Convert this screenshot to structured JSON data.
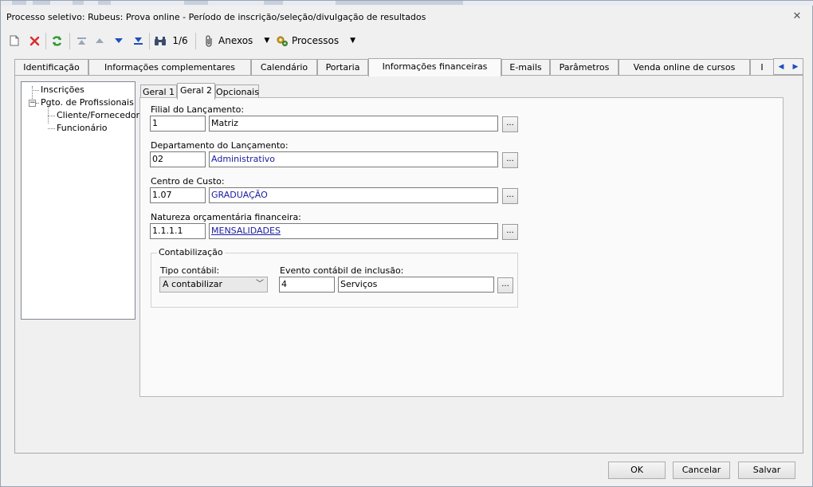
{
  "window": {
    "title": "Processo seletivo: Rubeus: Prova online - Período de inscrição/seleção/divulgação de resultados",
    "close_glyph": "✕"
  },
  "toolbar": {
    "record_counter": "1/6",
    "anexos_label": "Anexos",
    "processos_label": "Processos",
    "icons": [
      "new-document-icon",
      "delete-icon",
      "refresh-icon",
      "first-record-icon",
      "previous-record-icon",
      "next-record-icon",
      "last-record-icon",
      "binoculars-icon",
      "paperclip-icon",
      "gears-icon"
    ]
  },
  "tabs": [
    {
      "label": "Identificação"
    },
    {
      "label": "Informações complementares"
    },
    {
      "label": "Calendário"
    },
    {
      "label": "Portaria"
    },
    {
      "label": "Informações financeiras",
      "active": true
    },
    {
      "label": "E-mails"
    },
    {
      "label": "Parâmetros"
    },
    {
      "label": "Venda online de cursos"
    },
    {
      "label": "I"
    }
  ],
  "tree": {
    "items": [
      {
        "label": "Inscrições"
      },
      {
        "label": "Pgto. de Profissionais",
        "expander": "−"
      },
      {
        "label": "Cliente/Fornecedor"
      },
      {
        "label": "Funcionário"
      }
    ]
  },
  "subtabs": [
    {
      "label": "Geral 1"
    },
    {
      "label": "Geral 2",
      "active": true
    },
    {
      "label": "Opcionais"
    }
  ],
  "form": {
    "filial": {
      "label": "Filial do Lançamento:",
      "code": "1",
      "name": "Matriz"
    },
    "departamento": {
      "label": "Departamento do Lançamento:",
      "code": "02",
      "name": "Administrativo"
    },
    "centro_custo": {
      "label": "Centro de Custo:",
      "code": "1.07",
      "name": "GRADUAÇÃO"
    },
    "natureza": {
      "label": "Natureza orçamentária financeira:",
      "code": "1.1.1.1",
      "name": "MENSALIDADES"
    },
    "browse_label": "...",
    "contabilizacao": {
      "legend": "Contabilização",
      "tipo_label": "Tipo contábil:",
      "tipo_value": "A contabilizar",
      "evento_label": "Evento contábil de inclusão:",
      "evento_code": "4",
      "evento_name": "Serviços"
    }
  },
  "footer": {
    "ok": "OK",
    "cancel": "Cancelar",
    "save": "Salvar"
  },
  "colors": {
    "link_blue": "#1a1aa0",
    "delete_red": "#d92b2b",
    "refresh_green": "#2e9a2e",
    "nav_blue": "#1f4fbf"
  }
}
